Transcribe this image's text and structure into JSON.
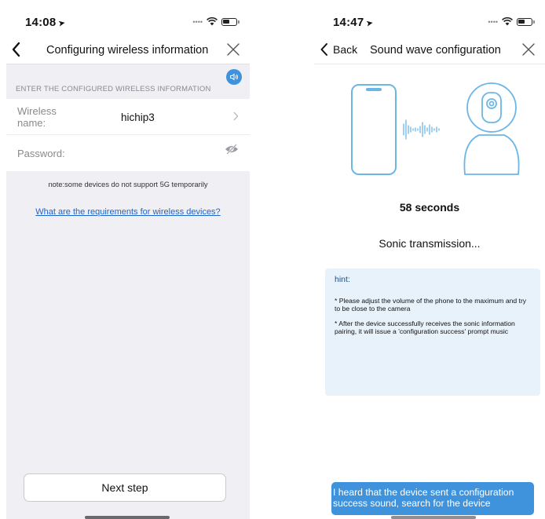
{
  "left_screen": {
    "status": {
      "time": "14:08"
    },
    "nav": {
      "title": "Configuring wireless information"
    },
    "section_header": "ENTER THE CONFIGURED WIRELESS INFORMATION",
    "form": {
      "wireless_label": "Wireless name:",
      "wireless_value": "hichip3",
      "password_label": "Password:",
      "password_value": ""
    },
    "note": "note:some devices do not support 5G temporarily",
    "requirements_link": "What are the requirements for wireless devices?",
    "next_button": "Next step"
  },
  "right_screen": {
    "status": {
      "time": "14:47"
    },
    "nav": {
      "back_label": "Back",
      "title": "Sound wave configuration"
    },
    "countdown": "58 seconds",
    "status_text": "Sonic transmission...",
    "hint": {
      "title": "hint:",
      "lines": [
        "* Please adjust the volume of the phone to the maximum and try to be close to the camera",
        "* After the device successfully receives the sonic information pairing, it will issue a 'configuration success' prompt music"
      ]
    },
    "search_button": {
      "line1": "I heard that the device sent a configuration",
      "line2": "success sound, search for the device"
    }
  },
  "colors": {
    "accent": "#3f93dd",
    "link": "#1f64c8",
    "hint_background": "#e7f2fb",
    "illustration_stroke": "#6cb6e6"
  }
}
